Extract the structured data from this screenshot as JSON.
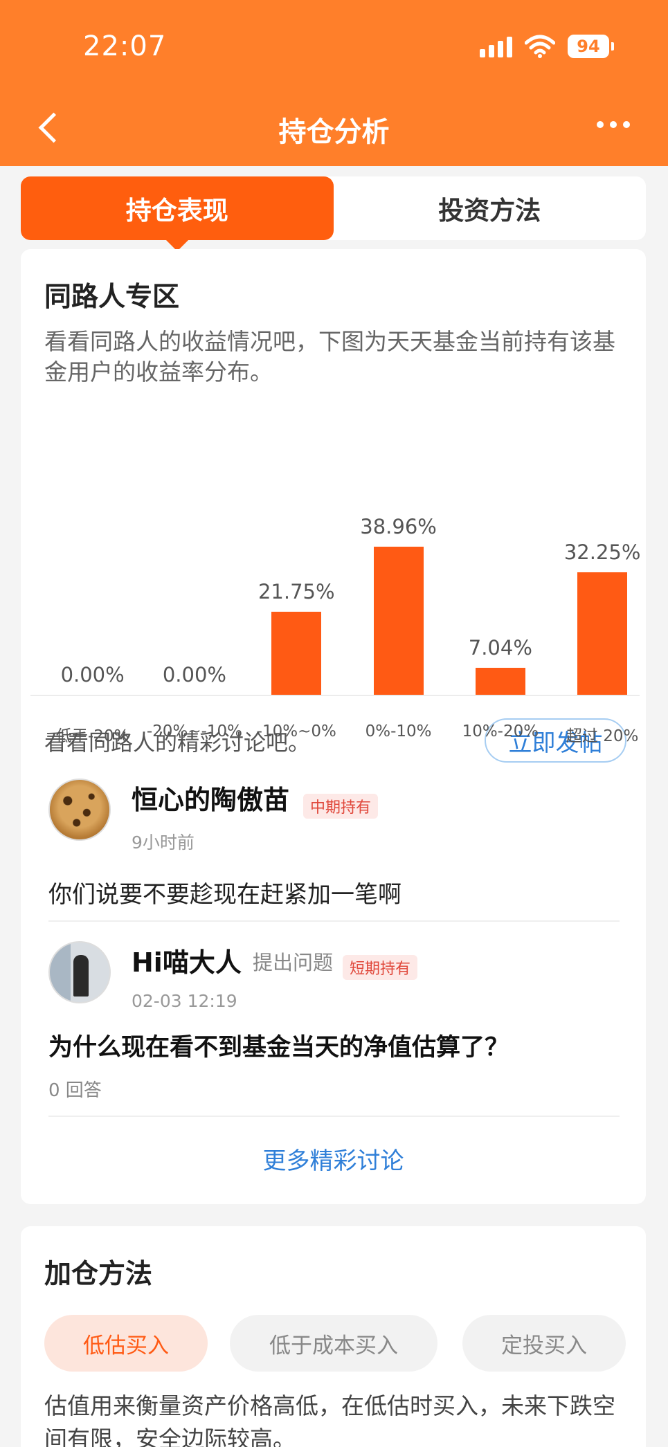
{
  "status_bar": {
    "time": "22:07",
    "battery": "94"
  },
  "header": {
    "title": "持仓分析"
  },
  "tabs": [
    {
      "label": "持仓表现",
      "active": true
    },
    {
      "label": "投资方法",
      "active": false
    }
  ],
  "peers": {
    "title": "同路人专区",
    "description": "看看同路人的收益情况吧，下图为天天基金当前持有该基金用户的收益率分布。"
  },
  "chart_data": {
    "type": "bar",
    "categories": [
      "低于-20%",
      "-20%~-10%",
      "-10%~0%",
      "0%-10%",
      "10%-20%",
      "超过 20%"
    ],
    "values": [
      0.0,
      0.0,
      21.75,
      38.96,
      7.04,
      32.25
    ],
    "labels": [
      "0.00%",
      "0.00%",
      "21.75%",
      "38.96%",
      "7.04%",
      "32.25%"
    ],
    "color": "#ff5a14",
    "ylim": [
      0,
      40
    ]
  },
  "discussion": {
    "prompt": "看看同路人的精彩讨论吧。",
    "post_button": "立即发帖",
    "more": "更多精彩讨论"
  },
  "posts": [
    {
      "username": "恒心的陶傲苗",
      "tag": "中期持有",
      "time": "9小时前",
      "content": "你们说要不要趁现在赶紧加一笔啊"
    },
    {
      "username": "Hi喵大人",
      "action": "提出问题",
      "tag": "短期持有",
      "time": "02-03 12:19",
      "content": "为什么现在看不到基金当天的净值估算了？",
      "answers": "0 回答"
    }
  ],
  "add_position": {
    "title": "加仓方法",
    "pills": [
      "低估买入",
      "低于成本买入",
      "定投买入"
    ],
    "description": "估值用来衡量资产价格高低，在低估时买入，未来下跌空间有限，安全边际较高。"
  },
  "colors": {
    "brand": "#ff7f2a",
    "accent": "#ff5e0e",
    "link": "#2f7fd8"
  }
}
